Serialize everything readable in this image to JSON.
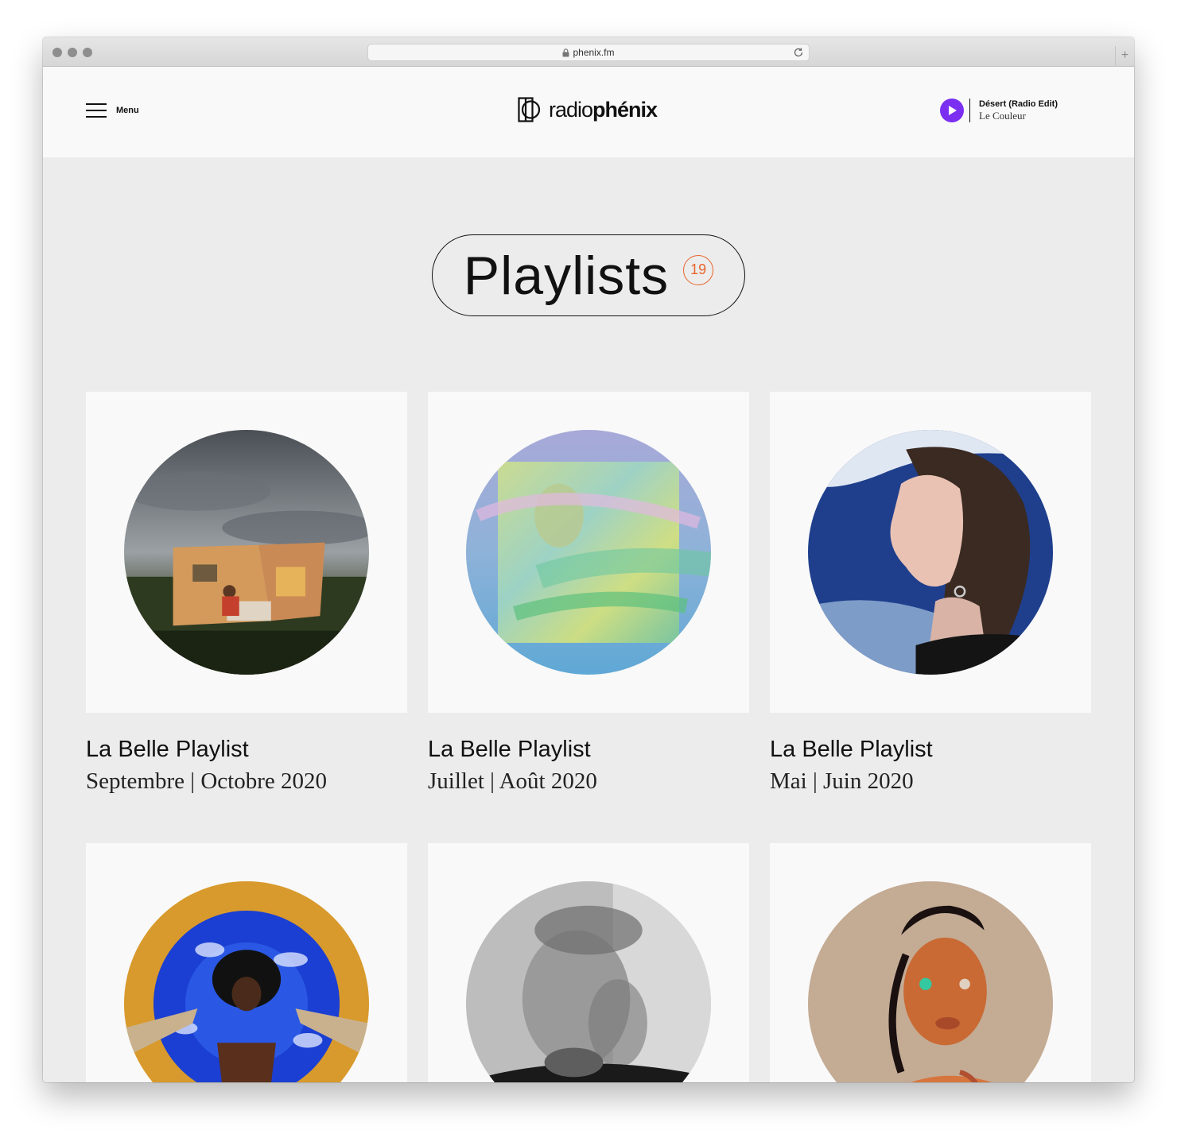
{
  "browser": {
    "url": "phenix.fm"
  },
  "header": {
    "menu_label": "Menu",
    "logo": {
      "light": "radio",
      "bold": "phénix"
    },
    "now_playing": {
      "title": "Désert (Radio Edit)",
      "artist": "Le Couleur"
    },
    "accent_color": "#7b2ff0"
  },
  "page": {
    "title": "Playlists",
    "count": "19",
    "count_color": "#e8652c"
  },
  "playlists": [
    {
      "title": "La Belle Playlist",
      "subtitle": "Septembre | Octobre 2020"
    },
    {
      "title": "La Belle Playlist",
      "subtitle": "Juillet | Août 2020"
    },
    {
      "title": "La Belle Playlist",
      "subtitle": "Mai | Juin 2020"
    },
    {
      "title": "",
      "subtitle": ""
    },
    {
      "title": "",
      "subtitle": ""
    },
    {
      "title": "",
      "subtitle": ""
    }
  ]
}
